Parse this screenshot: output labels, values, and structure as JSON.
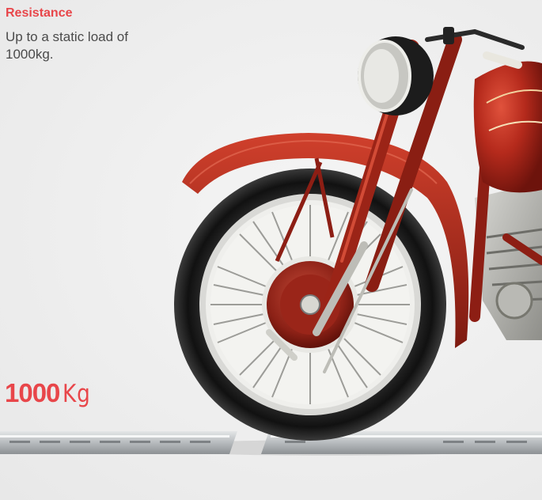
{
  "section": {
    "heading": "Resistance",
    "description": "Up to a static load of 1000kg."
  },
  "load_label": {
    "value": "1000",
    "unit": "Kg"
  },
  "colors": {
    "accent": "#e8464a",
    "text": "#4a4a4a",
    "background": "#f0f0f0",
    "motorcycle_red": "#a8231a"
  },
  "illustration": {
    "subject": "red vintage motorcycle front wheel resting on a floor rail"
  }
}
